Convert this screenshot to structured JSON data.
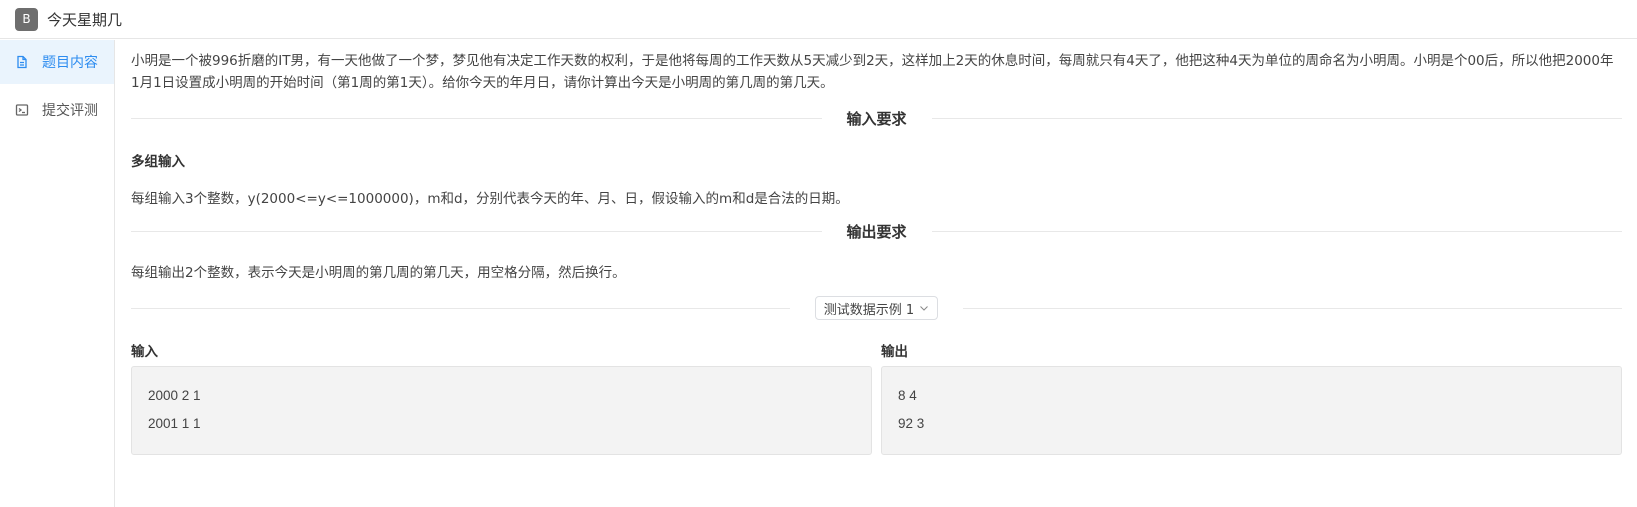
{
  "app": {
    "logo_letter": "B",
    "title": "今天星期几"
  },
  "sidebar": {
    "items": [
      {
        "label": "题目内容",
        "icon": "document-icon",
        "active": true
      },
      {
        "label": "提交评测",
        "icon": "terminal-icon",
        "active": false
      }
    ]
  },
  "problem": {
    "description": "小明是一个被996折磨的IT男，有一天他做了一个梦，梦见他有决定工作天数的权利，于是他将每周的工作天数从5天减少到2天，这样加上2天的休息时间，每周就只有4天了，他把这种4天为单位的周命名为小明周。小明是个00后，所以他把2000年1月1日设置成小明周的开始时间（第1周的第1天）。给你今天的年月日，请你计算出今天是小明周的第几周的第几天。",
    "input_heading": "输入要求",
    "input_subtitle": "多组输入",
    "input_text": "每组输入3个整数，y(2000<=y<=1000000)，m和d，分别代表今天的年、月、日，假设输入的m和d是合法的日期。",
    "output_heading": "输出要求",
    "output_text": "每组输出2个整数，表示今天是小明周的第几周的第几天，用空格分隔，然后换行。"
  },
  "sample": {
    "selector_label": "测试数据示例 1",
    "input_label": "输入",
    "output_label": "输出",
    "input_lines": [
      "2000 2 1",
      "2001 1 1"
    ],
    "output_lines": [
      "8 4",
      "92 3"
    ]
  },
  "colors": {
    "accent": "#2d8cf0",
    "active_bg": "#eaf4fd"
  }
}
